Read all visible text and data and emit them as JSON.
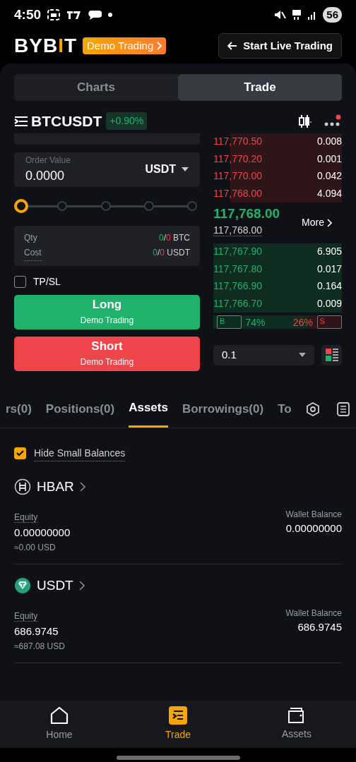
{
  "status_bar": {
    "time": "4:50",
    "battery": "56"
  },
  "header": {
    "logo": [
      "BYB",
      "I",
      "T"
    ],
    "demo_badge": "Demo Trading",
    "live_button": "Start Live Trading"
  },
  "view_tabs": [
    {
      "label": "Charts",
      "selected": false
    },
    {
      "label": "Trade",
      "selected": true
    }
  ],
  "symbol": {
    "name": "BTCUSDT",
    "change": "+0.90%",
    "notification": true
  },
  "order_form": {
    "order_value": {
      "label": "Order Value",
      "value": "0.0000",
      "unit": "USDT"
    },
    "slider": {
      "level": 0
    },
    "summary": [
      {
        "label": "Qty",
        "buy": "0",
        "separator": "/",
        "sell": "0",
        "unit": "BTC"
      },
      {
        "label": "Cost",
        "buy": "0",
        "separator": "/",
        "sell": "0",
        "unit": "USDT"
      }
    ],
    "tpsl": {
      "label": "TP/SL",
      "checked": false
    },
    "buttons": [
      {
        "kind": "long",
        "label": "Long",
        "sublabel": "Demo Trading"
      },
      {
        "kind": "short",
        "label": "Short",
        "sublabel": "Demo Trading"
      }
    ]
  },
  "order_book": {
    "asks": [
      {
        "price": "117,770.50",
        "size": "0.008"
      },
      {
        "price": "117,770.20",
        "size": "0.001"
      },
      {
        "price": "117,770.00",
        "size": "0.042"
      },
      {
        "price": "117,768.00",
        "size": "4.094"
      }
    ],
    "last_price": "117,768.00",
    "mark_price": "117,768.00",
    "more": "More",
    "bids": [
      {
        "price": "117,767.90",
        "size": "6.905"
      },
      {
        "price": "117,767.80",
        "size": "0.017"
      },
      {
        "price": "117,766.90",
        "size": "0.164"
      },
      {
        "price": "117,766.70",
        "size": "0.009"
      }
    ],
    "ratio": {
      "buy_badge": "B",
      "buy": "74%",
      "sell": "26%",
      "sell_badge": "S",
      "level": 0.74
    },
    "precision": "0.1"
  },
  "position_tabs": [
    {
      "label": "rs(0)",
      "selected": false
    },
    {
      "label": "Positions(0)",
      "selected": false
    },
    {
      "label": "Assets",
      "selected": true
    },
    {
      "label": "Borrowings(0)",
      "selected": false
    },
    {
      "label": "To",
      "selected": false
    }
  ],
  "hide_small": {
    "label": "Hide Small Balances",
    "checked": true
  },
  "assets": [
    {
      "kind": "hbar",
      "symbol": "HBAR",
      "equity_label": "Equity",
      "equity": "0.00000000",
      "equity_usd": "≈0.00 USD",
      "wallet_label": "Wallet Balance",
      "wallet": "0.00000000"
    },
    {
      "kind": "usdt",
      "symbol": "USDT",
      "equity_label": "Equity",
      "equity": "686.9745",
      "equity_usd": "≈687.08 USD",
      "wallet_label": "Wallet Balance",
      "wallet": "686.9745"
    }
  ],
  "bottom_nav": [
    {
      "kind": "home",
      "label": "Home",
      "selected": false
    },
    {
      "kind": "trade",
      "label": "Trade",
      "selected": true
    },
    {
      "kind": "wallet",
      "label": "Assets",
      "selected": false
    }
  ]
}
